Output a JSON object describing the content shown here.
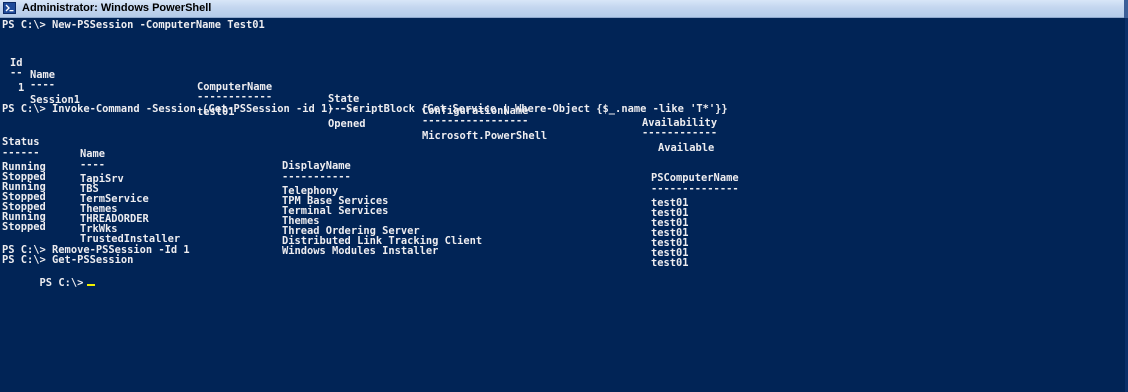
{
  "window": {
    "title": "Administrator: Windows PowerShell"
  },
  "console": {
    "cmd1": "PS C:\\> New-PSSession -ComputerName Test01",
    "session_table": {
      "headers": [
        "Id",
        "Name",
        "ComputerName",
        "State",
        "ConfigurationName",
        "Availability"
      ],
      "underlines": [
        "--",
        "----",
        "------------",
        "-----",
        "-----------------",
        "------------"
      ],
      "row": [
        "1",
        "Session1",
        "test01",
        "Opened",
        "Microsoft.PowerShell",
        "Available"
      ]
    },
    "cmd2": "PS C:\\> Invoke-Command -Session (Get-PSSession -id 1) -ScriptBlock {Get-Service | Where-Object {$_.name -like 'T*'}}",
    "service_table": {
      "headers": [
        "Status",
        "Name",
        "DisplayName",
        "PSComputerName"
      ],
      "underlines": [
        "------",
        "----",
        "-----------",
        "--------------"
      ],
      "rows": [
        [
          "Running",
          "TapiSrv",
          "Telephony",
          "test01"
        ],
        [
          "Stopped",
          "TBS",
          "TPM Base Services",
          "test01"
        ],
        [
          "Running",
          "TermService",
          "Terminal Services",
          "test01"
        ],
        [
          "Stopped",
          "Themes",
          "Themes",
          "test01"
        ],
        [
          "Stopped",
          "THREADORDER",
          "Thread Ordering Server",
          "test01"
        ],
        [
          "Running",
          "TrkWks",
          "Distributed Link Tracking Client",
          "test01"
        ],
        [
          "Stopped",
          "TrustedInstaller",
          "Windows Modules Installer",
          "test01"
        ]
      ]
    },
    "cmd3": "PS C:\\> Remove-PSSession -Id 1",
    "cmd4": "PS C:\\> Get-PSSession",
    "prompt": "PS C:\\>"
  },
  "colors": {
    "background": "#012456",
    "text": "#eeedf0",
    "cursor": "#f0f000"
  },
  "icons": {
    "title": "powershell-icon"
  }
}
